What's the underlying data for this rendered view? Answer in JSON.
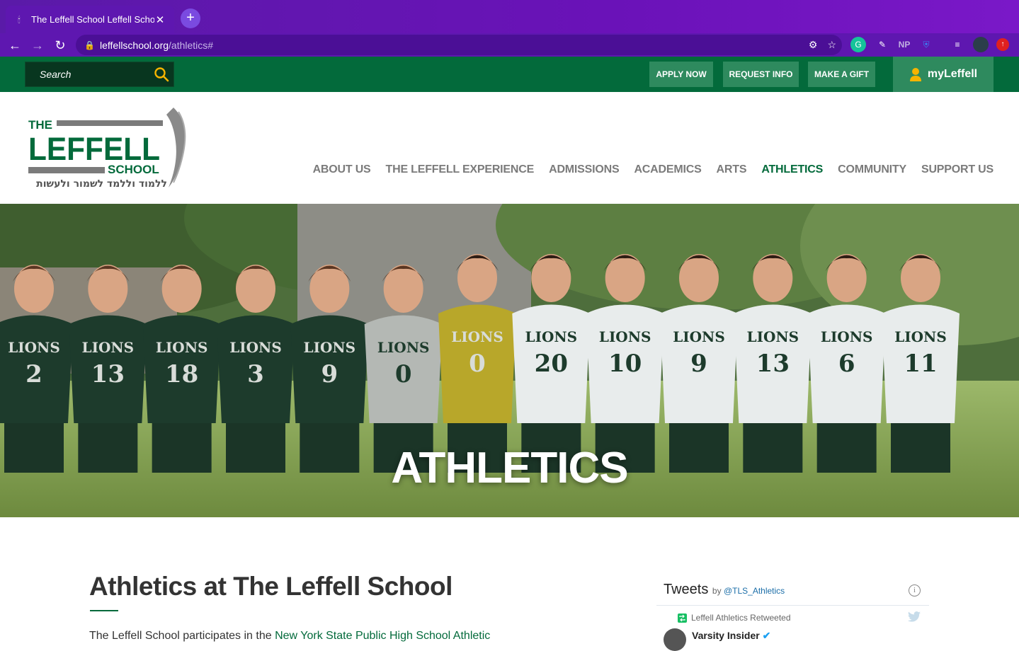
{
  "browser": {
    "tab_title": "The Leffell School Leffell Scho",
    "url_host": "leffellschool.org",
    "url_path": "/athletics#",
    "extensions": [
      "NP"
    ]
  },
  "utility": {
    "search_placeholder": "Search",
    "apply_label": "APPLY NOW",
    "request_label": "REQUEST INFO",
    "gift_label": "MAKE A GIFT",
    "myleffell_label": "myLeffell"
  },
  "logo": {
    "line1": "THE",
    "line2": "LEFFELL",
    "line3": "SCHOOL",
    "hebrew": "ללמוד וללמד לשמור ולעשות"
  },
  "nav": {
    "items": [
      {
        "label": "ABOUT US"
      },
      {
        "label": "THE LEFFELL EXPERIENCE"
      },
      {
        "label": "ADMISSIONS"
      },
      {
        "label": "ACADEMICS"
      },
      {
        "label": "ARTS"
      },
      {
        "label": "ATHLETICS",
        "active": true
      },
      {
        "label": "COMMUNITY"
      },
      {
        "label": "SUPPORT US"
      }
    ]
  },
  "hero": {
    "title": "ATHLETICS",
    "jersey_text": "LIONS",
    "jersey_numbers": [
      "2",
      "13",
      "18",
      "3",
      "9",
      "0",
      "0",
      "20",
      "10",
      "9",
      "13",
      "6",
      "11"
    ]
  },
  "content": {
    "title": "Athletics at The Leffell School",
    "intro_start": "The Leffell School participates in the ",
    "intro_link": "New York State Public High School Athletic"
  },
  "twitter": {
    "heading": "Tweets",
    "by": "by",
    "handle": "@TLS_Athletics",
    "retweet_line": "Leffell Athletics Retweeted",
    "author": "Varsity Insider"
  },
  "colors": {
    "brand_green": "#036a3b",
    "button_green": "#2e8a5e",
    "nav_gray": "#7b7b7b",
    "chrome_purple": "#5e17b0"
  }
}
